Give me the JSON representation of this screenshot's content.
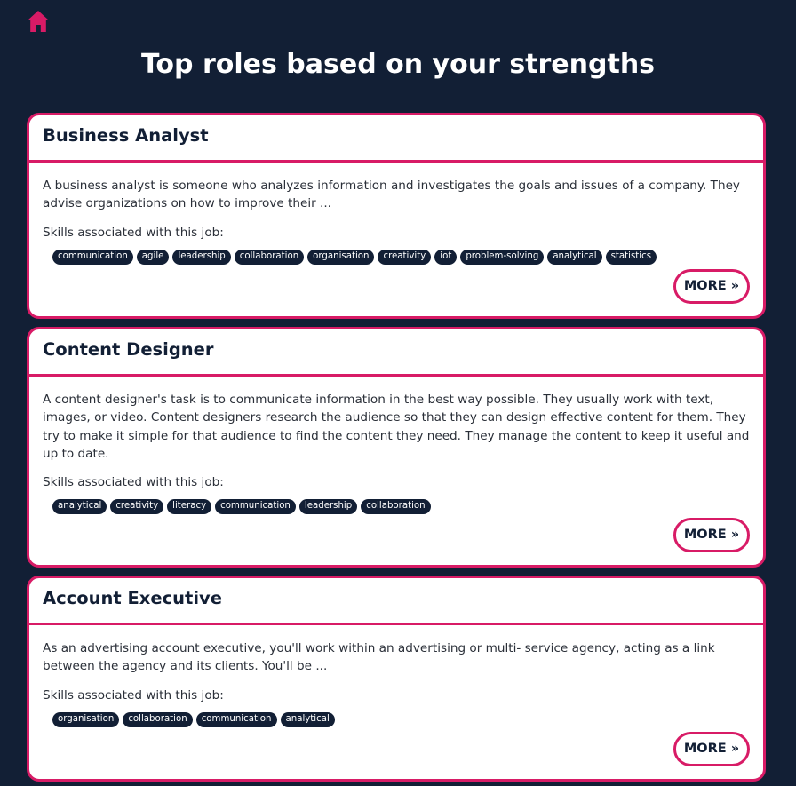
{
  "colors": {
    "background": "#121f35",
    "accent": "#d81b66",
    "card": "#ffffff",
    "tag_bg": "#121f35"
  },
  "header": {
    "home_icon": "home-icon",
    "title": "Top roles based on your strengths"
  },
  "roles": [
    {
      "title": "Business Analyst",
      "description": "A business analyst is someone who analyzes information and investigates the goals and issues of a company. They advise organizations on how to improve their ...",
      "skills_label": "Skills associated with this job:",
      "skills": [
        "communication",
        "agile",
        "leadership",
        "collaboration",
        "organisation",
        "creativity",
        "iot",
        "problem-solving",
        "analytical",
        "statistics"
      ],
      "more_label": "MORE »"
    },
    {
      "title": "Content Designer",
      "description": "A content designer's task is to communicate information in the best way possible. They usually work with text, images, or video. Content designers research the audience so that they can design effective content for them. They try to make it simple for that audience to find the content they need. They manage the content to keep it useful and up to date.",
      "skills_label": "Skills associated with this job:",
      "skills": [
        "analytical",
        "creativity",
        "literacy",
        "communication",
        "leadership",
        "collaboration"
      ],
      "more_label": "MORE »"
    },
    {
      "title": "Account Executive",
      "description": "As an advertising account executive, you'll work within an advertising or multi- service agency, acting as a link between the agency and its clients. You'll be ...",
      "skills_label": "Skills associated with this job:",
      "skills": [
        "organisation",
        "collaboration",
        "communication",
        "analytical"
      ],
      "more_label": "MORE »"
    }
  ]
}
